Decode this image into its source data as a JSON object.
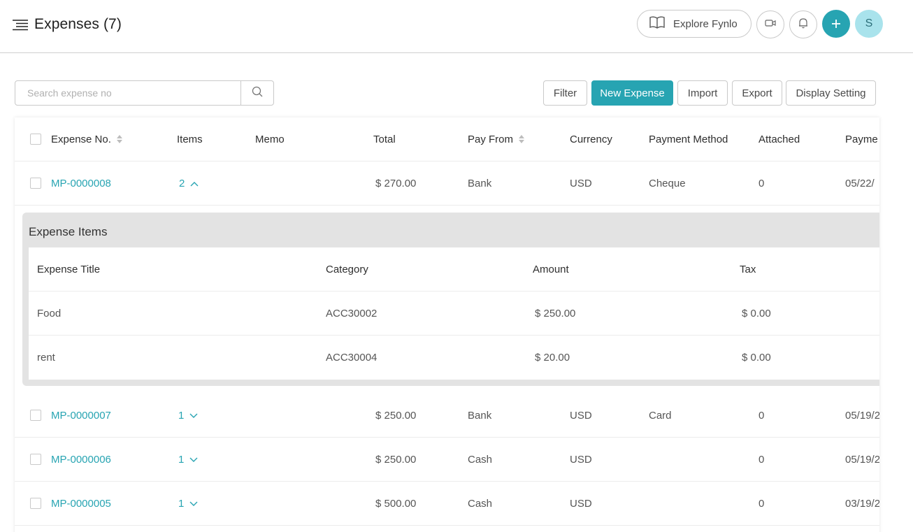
{
  "header": {
    "title": "Expenses (7)",
    "explore_label": "Explore Fynlo",
    "avatar_initial": "S"
  },
  "search": {
    "placeholder": "Search expense no"
  },
  "toolbar": {
    "filter": "Filter",
    "new_expense": "New Expense",
    "import": "Import",
    "export": "Export",
    "display_setting": "Display Setting"
  },
  "columns": [
    "Expense No.",
    "Items",
    "Memo",
    "Total",
    "Pay From",
    "Currency",
    "Payment Method",
    "Attached",
    "Payme"
  ],
  "rows": [
    {
      "no": "MP-0000008",
      "items": "2",
      "memo": "",
      "total": "$ 270.00",
      "pay_from": "Bank",
      "currency": "USD",
      "method": "Cheque",
      "attached": "0",
      "date": "05/22/"
    },
    {
      "no": "MP-0000007",
      "items": "1",
      "memo": "",
      "total": "$ 250.00",
      "pay_from": "Bank",
      "currency": "USD",
      "method": "Card",
      "attached": "0",
      "date": "05/19/2"
    },
    {
      "no": "MP-0000006",
      "items": "1",
      "memo": "",
      "total": "$ 250.00",
      "pay_from": "Cash",
      "currency": "USD",
      "method": "",
      "attached": "0",
      "date": "05/19/2"
    },
    {
      "no": "MP-0000005",
      "items": "1",
      "memo": "",
      "total": "$ 500.00",
      "pay_from": "Cash",
      "currency": "USD",
      "method": "",
      "attached": "0",
      "date": "03/19/2"
    }
  ],
  "expense_items": {
    "title": "Expense Items",
    "columns": [
      "Expense Title",
      "Category",
      "Amount",
      "Tax"
    ],
    "rows": [
      {
        "title": "Food",
        "category": "ACC30002",
        "amount": "$ 250.00",
        "tax": "$ 0.00"
      },
      {
        "title": "rent",
        "category": "ACC30004",
        "amount": "$ 20.00",
        "tax": "$ 0.00"
      }
    ]
  },
  "colors": {
    "accent": "#27a4b2",
    "avatar_bg": "#a9e3ec",
    "panel_bg": "#e3e3e3"
  },
  "icons": [
    "menu-icon",
    "book-icon",
    "video-icon",
    "bell-icon",
    "plus-icon",
    "search-icon",
    "sort-icon",
    "chevron-up-icon",
    "chevron-down-icon"
  ]
}
